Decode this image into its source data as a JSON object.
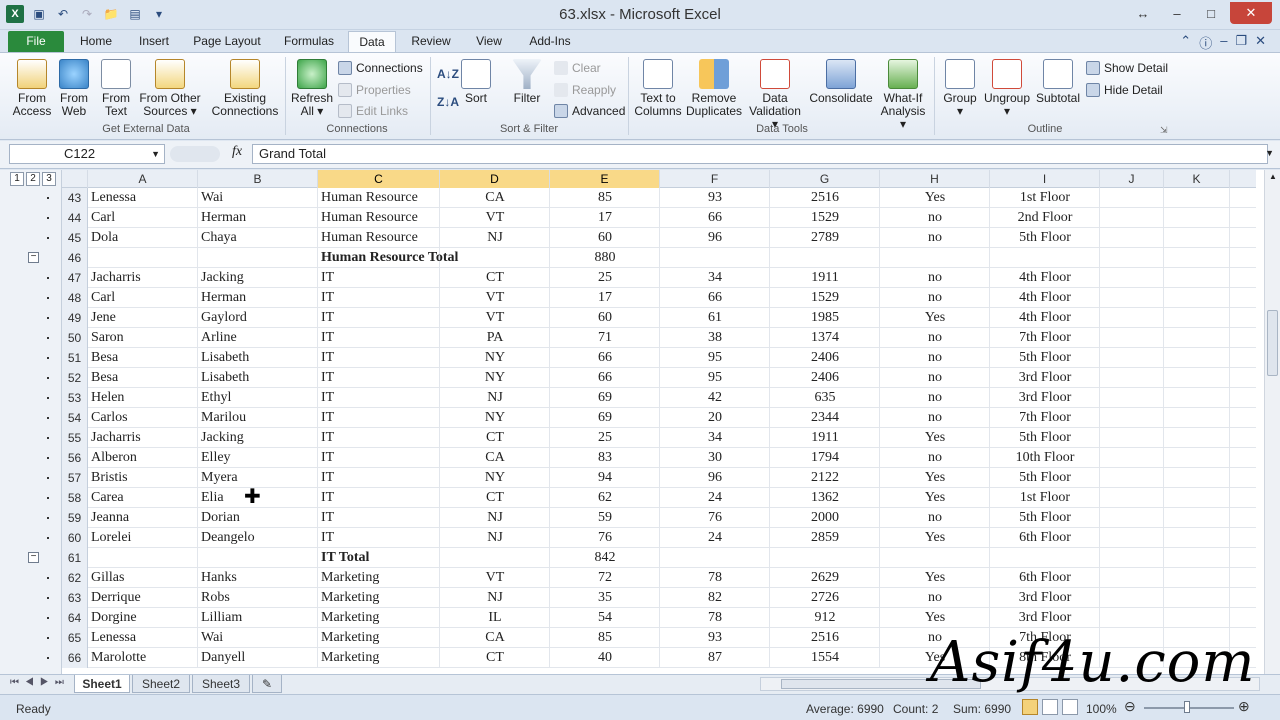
{
  "window": {
    "title": "63.xlsx - Microsoft Excel"
  },
  "tabs": [
    "File",
    "Home",
    "Insert",
    "Page Layout",
    "Formulas",
    "Data",
    "Review",
    "View",
    "Add-Ins"
  ],
  "ribbon": {
    "get_external": {
      "from_access": "From\nAccess",
      "from_web": "From\nWeb",
      "from_text": "From\nText",
      "from_other": "From Other\nSources ▾",
      "existing": "Existing\nConnections",
      "label": "Get External Data"
    },
    "connections": {
      "refresh": "Refresh\nAll ▾",
      "connections": "Connections",
      "properties": "Properties",
      "edit_links": "Edit Links",
      "label": "Connections"
    },
    "sort": {
      "sort": "Sort",
      "filter": "Filter",
      "clear": "Clear",
      "reapply": "Reapply",
      "advanced": "Advanced",
      "label": "Sort & Filter"
    },
    "tools": {
      "text_to_columns": "Text to\nColumns",
      "remove_dup": "Remove\nDuplicates",
      "validation": "Data\nValidation ▾",
      "consolidate": "Consolidate",
      "whatif": "What-If\nAnalysis ▾",
      "label": "Data Tools"
    },
    "outline": {
      "group": "Group\n▾",
      "ungroup": "Ungroup\n▾",
      "subtotal": "Subtotal",
      "show_detail": "Show Detail",
      "hide_detail": "Hide Detail",
      "label": "Outline"
    }
  },
  "formula_bar": {
    "name_box": "C122",
    "fx": "fx",
    "formula": "Grand Total"
  },
  "outline_levels": [
    "1",
    "2",
    "3"
  ],
  "columns": [
    "A",
    "B",
    "C",
    "D",
    "E",
    "F",
    "G",
    "H",
    "I",
    "J",
    "K"
  ],
  "rows": [
    {
      "n": "43",
      "a": "Lenessa",
      "b": "Wai",
      "c": "Human Resource",
      "d": "CA",
      "e": "85",
      "f": "93",
      "g": "2516",
      "h": "Yes",
      "i": "1st Floor"
    },
    {
      "n": "44",
      "a": "Carl",
      "b": "Herman",
      "c": "Human Resource",
      "d": "VT",
      "e": "17",
      "f": "66",
      "g": "1529",
      "h": "no",
      "i": "2nd Floor"
    },
    {
      "n": "45",
      "a": "Dola",
      "b": "Chaya",
      "c": "Human Resource",
      "d": "NJ",
      "e": "60",
      "f": "96",
      "g": "2789",
      "h": "no",
      "i": "5th Floor"
    },
    {
      "n": "46",
      "a": "",
      "b": "",
      "c": "Human Resource Total",
      "d": "",
      "e": "880",
      "f": "",
      "g": "",
      "h": "",
      "i": "",
      "total": true
    },
    {
      "n": "47",
      "a": "Jacharris",
      "b": "Jacking",
      "c": "IT",
      "d": "CT",
      "e": "25",
      "f": "34",
      "g": "1911",
      "h": "no",
      "i": "4th Floor"
    },
    {
      "n": "48",
      "a": "Carl",
      "b": "Herman",
      "c": "IT",
      "d": "VT",
      "e": "17",
      "f": "66",
      "g": "1529",
      "h": "no",
      "i": "4th Floor"
    },
    {
      "n": "49",
      "a": "Jene",
      "b": "Gaylord",
      "c": "IT",
      "d": "VT",
      "e": "60",
      "f": "61",
      "g": "1985",
      "h": "Yes",
      "i": "4th Floor"
    },
    {
      "n": "50",
      "a": "Saron",
      "b": "Arline",
      "c": "IT",
      "d": "PA",
      "e": "71",
      "f": "38",
      "g": "1374",
      "h": "no",
      "i": "7th Floor"
    },
    {
      "n": "51",
      "a": "Besa",
      "b": "Lisabeth",
      "c": "IT",
      "d": "NY",
      "e": "66",
      "f": "95",
      "g": "2406",
      "h": "no",
      "i": "5th Floor"
    },
    {
      "n": "52",
      "a": "Besa",
      "b": "Lisabeth",
      "c": "IT",
      "d": "NY",
      "e": "66",
      "f": "95",
      "g": "2406",
      "h": "no",
      "i": "3rd Floor"
    },
    {
      "n": "53",
      "a": "Helen",
      "b": "Ethyl",
      "c": "IT",
      "d": "NJ",
      "e": "69",
      "f": "42",
      "g": "635",
      "h": "no",
      "i": "3rd Floor"
    },
    {
      "n": "54",
      "a": "Carlos",
      "b": "Marilou",
      "c": "IT",
      "d": "NY",
      "e": "69",
      "f": "20",
      "g": "2344",
      "h": "no",
      "i": "7th Floor"
    },
    {
      "n": "55",
      "a": "Jacharris",
      "b": "Jacking",
      "c": "IT",
      "d": "CT",
      "e": "25",
      "f": "34",
      "g": "1911",
      "h": "Yes",
      "i": "5th Floor"
    },
    {
      "n": "56",
      "a": "Alberon",
      "b": "Elley",
      "c": "IT",
      "d": "CA",
      "e": "83",
      "f": "30",
      "g": "1794",
      "h": "no",
      "i": "10th Floor"
    },
    {
      "n": "57",
      "a": "Bristis",
      "b": "Myera",
      "c": "IT",
      "d": "NY",
      "e": "94",
      "f": "96",
      "g": "2122",
      "h": "Yes",
      "i": "5th Floor"
    },
    {
      "n": "58",
      "a": "Carea",
      "b": "Elia",
      "c": "IT",
      "d": "CT",
      "e": "62",
      "f": "24",
      "g": "1362",
      "h": "Yes",
      "i": "1st Floor"
    },
    {
      "n": "59",
      "a": "Jeanna",
      "b": "Dorian",
      "c": "IT",
      "d": "NJ",
      "e": "59",
      "f": "76",
      "g": "2000",
      "h": "no",
      "i": "5th Floor"
    },
    {
      "n": "60",
      "a": "Lorelei",
      "b": "Deangelo",
      "c": "IT",
      "d": "NJ",
      "e": "76",
      "f": "24",
      "g": "2859",
      "h": "Yes",
      "i": "6th Floor"
    },
    {
      "n": "61",
      "a": "",
      "b": "",
      "c": "IT Total",
      "d": "",
      "e": "842",
      "f": "",
      "g": "",
      "h": "",
      "i": "",
      "total": true
    },
    {
      "n": "62",
      "a": "Gillas",
      "b": "Hanks",
      "c": "Marketing",
      "d": "VT",
      "e": "72",
      "f": "78",
      "g": "2629",
      "h": "Yes",
      "i": "6th Floor"
    },
    {
      "n": "63",
      "a": "Derrique",
      "b": "Robs",
      "c": "Marketing",
      "d": "NJ",
      "e": "35",
      "f": "82",
      "g": "2726",
      "h": "no",
      "i": "3rd Floor"
    },
    {
      "n": "64",
      "a": "Dorgine",
      "b": "Lilliam",
      "c": "Marketing",
      "d": "IL",
      "e": "54",
      "f": "78",
      "g": "912",
      "h": "Yes",
      "i": "3rd Floor"
    },
    {
      "n": "65",
      "a": "Lenessa",
      "b": "Wai",
      "c": "Marketing",
      "d": "CA",
      "e": "85",
      "f": "93",
      "g": "2516",
      "h": "no",
      "i": "7th Floor"
    },
    {
      "n": "66",
      "a": "Marolotte",
      "b": "Danyell",
      "c": "Marketing",
      "d": "CT",
      "e": "40",
      "f": "87",
      "g": "1554",
      "h": "Yes",
      "i": "8th Floor"
    }
  ],
  "sheets": [
    "Sheet1",
    "Sheet2",
    "Sheet3"
  ],
  "status": {
    "ready": "Ready",
    "average": "Average: 6990",
    "count": "Count: 2",
    "sum": "Sum: 6990",
    "zoom": "100%"
  },
  "watermark": "Asif4u.com"
}
